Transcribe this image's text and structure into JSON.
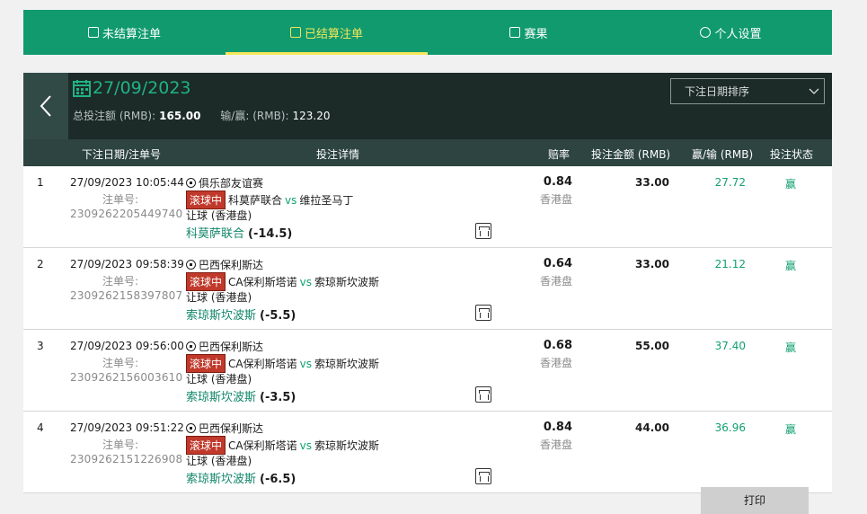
{
  "tabs": [
    {
      "label": "未结算注单",
      "icon": "receipt-icon"
    },
    {
      "label": "已结算注单",
      "icon": "receipt-check-icon"
    },
    {
      "label": "赛果",
      "icon": "results-icon"
    },
    {
      "label": "个人设置",
      "icon": "settings-icon"
    }
  ],
  "header": {
    "date": "27/09/2023",
    "total_label": "总投注额 (RMB):",
    "total_value": "165.00",
    "winloss_label": "输/赢: (RMB):",
    "winloss_value": "123.20",
    "sort_label": "下注日期排序"
  },
  "columns": {
    "date_id": "下注日期/注单号",
    "detail": "投注详情",
    "odds": "赔率",
    "stake": "投注金额 (RMB)",
    "winloss": "赢/输 (RMB)",
    "status": "投注状态"
  },
  "order_label": "注单号:",
  "live_label": "滚球中",
  "vs_label": "vs",
  "bets": [
    {
      "num": "1",
      "datetime": "27/09/2023 10:05:44",
      "order_id": "2309262205449740",
      "league": "俱乐部友谊赛",
      "home": "科莫萨联合",
      "away": "维拉圣马丁",
      "market": "让球 (香港盘)",
      "selection": "科莫萨联合",
      "handicap": "(-14.5)",
      "odds": "0.84",
      "odds_type": "香港盘",
      "stake": "33.00",
      "winloss": "27.72",
      "status": "赢"
    },
    {
      "num": "2",
      "datetime": "27/09/2023 09:58:39",
      "order_id": "2309262158397807",
      "league": "巴西保利斯达",
      "home": "CA保利斯塔诺",
      "away": "索琼斯坎波斯",
      "market": "让球 (香港盘)",
      "selection": "索琼斯坎波斯",
      "handicap": "(-5.5)",
      "odds": "0.64",
      "odds_type": "香港盘",
      "stake": "33.00",
      "winloss": "21.12",
      "status": "赢"
    },
    {
      "num": "3",
      "datetime": "27/09/2023 09:56:00",
      "order_id": "2309262156003610",
      "league": "巴西保利斯达",
      "home": "CA保利斯塔诺",
      "away": "索琼斯坎波斯",
      "market": "让球 (香港盘)",
      "selection": "索琼斯坎波斯",
      "handicap": "(-3.5)",
      "odds": "0.68",
      "odds_type": "香港盘",
      "stake": "55.00",
      "winloss": "37.40",
      "status": "赢"
    },
    {
      "num": "4",
      "datetime": "27/09/2023 09:51:22",
      "order_id": "2309262151226908",
      "league": "巴西保利斯达",
      "home": "CA保利斯塔诺",
      "away": "索琼斯坎波斯",
      "market": "让球 (香港盘)",
      "selection": "索琼斯坎波斯",
      "handicap": "(-6.5)",
      "odds": "0.84",
      "odds_type": "香港盘",
      "stake": "44.00",
      "winloss": "36.96",
      "status": "赢"
    }
  ],
  "print_label": "打印",
  "colors": {
    "brand": "#109a6e",
    "active": "#f5e65a",
    "header_bg": "#1c2a28",
    "win": "#12a070",
    "live": "#c0392b"
  }
}
